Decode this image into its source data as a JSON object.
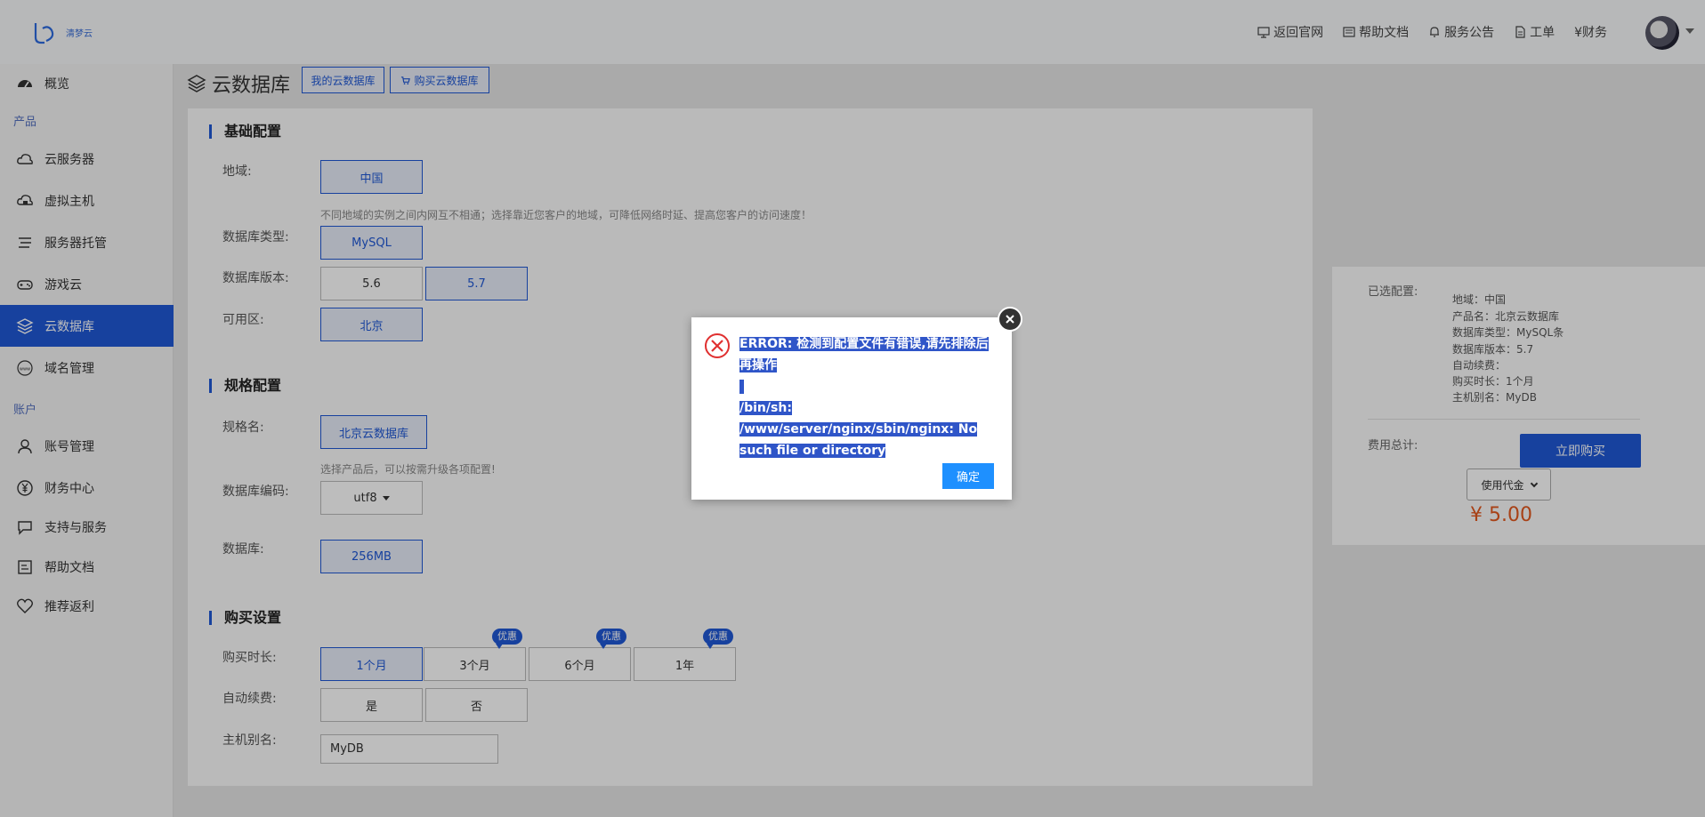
{
  "brand": {
    "logo_text": "清梦云"
  },
  "topnav": [
    {
      "label": "返回官网",
      "icon": "monitor-icon"
    },
    {
      "label": "帮助文档",
      "icon": "document-icon"
    },
    {
      "label": "服务公告",
      "icon": "bell-icon"
    },
    {
      "label": "工单",
      "icon": "ticket-icon"
    },
    {
      "label": "¥财务",
      "icon": ""
    }
  ],
  "sidebar": {
    "items": [
      {
        "label": "概览"
      },
      {
        "label": "云服务器"
      },
      {
        "label": "虚拟主机"
      },
      {
        "label": "服务器托管"
      },
      {
        "label": "游戏云"
      },
      {
        "label": "云数据库"
      },
      {
        "label": "域名管理"
      },
      {
        "label": "账号管理"
      },
      {
        "label": "财务中心"
      },
      {
        "label": "支持与服务"
      },
      {
        "label": "帮助文档"
      },
      {
        "label": "推荐返利"
      }
    ],
    "section_product": "产品",
    "section_account": "账户"
  },
  "page": {
    "title": "云数据库",
    "tab_my": "我的云数据库",
    "tab_buy": "购买云数据库"
  },
  "basic": {
    "title": "基础配置",
    "region_label": "地域:",
    "region_value": "中国",
    "region_hint": "不同地域的实例之间内网互不相通；选择靠近您客户的地域，可降低网络时延、提高您客户的访问速度！",
    "dbtype_label": "数据库类型:",
    "dbtype_value": "MySQL",
    "version_label": "数据库版本:",
    "version_options": [
      "5.6",
      "5.7"
    ],
    "zone_label": "可用区:",
    "zone_value": "北京"
  },
  "spec": {
    "title": "规格配置",
    "name_label": "规格名:",
    "name_value": "北京云数据库",
    "name_hint": "选择产品后，可以按需升级各项配置!",
    "encoding_label": "数据库编码:",
    "encoding_value": "utf8",
    "db_label": "数据库:",
    "db_value": "256MB"
  },
  "purchase": {
    "title": "购买设置",
    "duration_label": "购买时长:",
    "durations": [
      "1个月",
      "3个月",
      "6个月",
      "1年"
    ],
    "discount_badge": "优惠",
    "renew_label": "自动续费:",
    "renew_options": [
      "是",
      "否"
    ],
    "alias_label": "主机别名:",
    "alias_value": "MyDB"
  },
  "summary": {
    "selected_label": "已选配置:",
    "lines": [
      "地域：中国",
      "产品名：北京云数据库",
      "数据库类型：MySQL条",
      "数据库版本：5.7",
      "自动续费：",
      "购买时长：1个月",
      "主机别名：MyDB"
    ],
    "total_label": "费用总计:",
    "buy_button": "立即购买",
    "voucher_select": "使用代金",
    "price": "¥ 5.00"
  },
  "dialog": {
    "line1": "ERROR: 检测到配置文件有错误,请先排除后再操作",
    "line2": "/bin/sh: /www/server/nginx/sbin/nginx: No such file or directory",
    "ok_label": "确定"
  }
}
